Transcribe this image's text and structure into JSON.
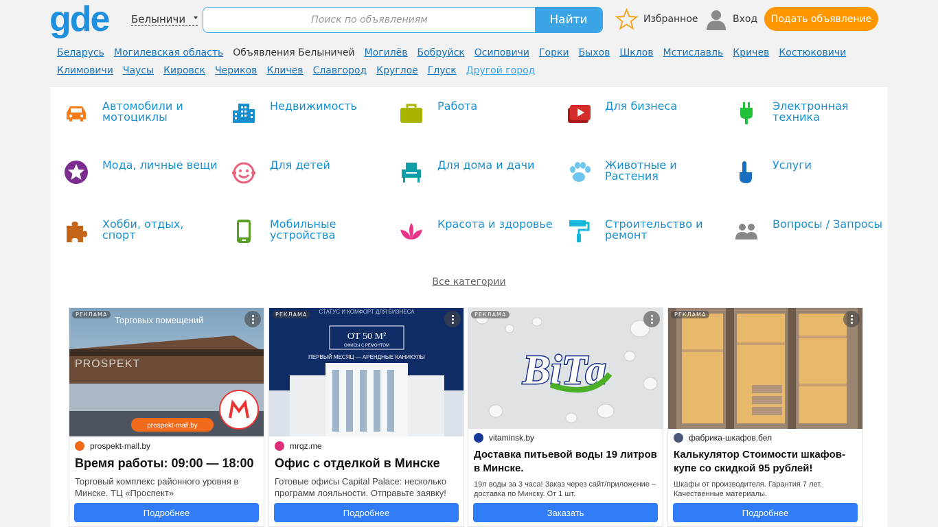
{
  "header": {
    "logo": "gde",
    "city": "Белыничи",
    "search_placeholder": "Поиск по объявлениям",
    "search_button": "Найти",
    "favorites": "Избранное",
    "login": "Вход",
    "post_ad": "Подать объявление",
    "accent": "#3ba5e8",
    "post_color": "#ff9800"
  },
  "cities": [
    {
      "label": "Беларусь"
    },
    {
      "label": "Могилевская область"
    },
    {
      "label": "Объявления Белыничей",
      "current": true
    },
    {
      "label": "Могилёв"
    },
    {
      "label": "Бобруйск"
    },
    {
      "label": "Осиповичи"
    },
    {
      "label": "Горки"
    },
    {
      "label": "Быхов"
    },
    {
      "label": "Шклов"
    },
    {
      "label": "Мстиславль"
    },
    {
      "label": "Кричев"
    },
    {
      "label": "Костюковичи"
    },
    {
      "label": "Климовичи"
    },
    {
      "label": "Чаусы"
    },
    {
      "label": "Кировск"
    },
    {
      "label": "Чериков"
    },
    {
      "label": "Кличев"
    },
    {
      "label": "Славгород"
    },
    {
      "label": "Круглое"
    },
    {
      "label": "Глуск"
    },
    {
      "label": "Другой город",
      "other": true
    }
  ],
  "categories": [
    {
      "label": "Автомобили и мотоциклы",
      "icon": "car-icon",
      "color": "#f47c1c"
    },
    {
      "label": "Недвижимость",
      "icon": "building-icon",
      "color": "#1a8fd0"
    },
    {
      "label": "Работа",
      "icon": "briefcase-icon",
      "color": "#a8b400"
    },
    {
      "label": "Для бизнеса",
      "icon": "video-icon",
      "color": "#d42b2b"
    },
    {
      "label": "Электронная техника",
      "icon": "plug-icon",
      "color": "#22c13b"
    },
    {
      "label": "Мода, личные вещи",
      "icon": "star-icon",
      "color": "#7b2d8f"
    },
    {
      "label": "Для детей",
      "icon": "smile-icon",
      "color": "#e8607a"
    },
    {
      "label": "Для дома и дачи",
      "icon": "armchair-icon",
      "color": "#0e9fa8"
    },
    {
      "label": "Животные и Растения",
      "icon": "paw-icon",
      "color": "#6ec6ee"
    },
    {
      "label": "Услуги",
      "icon": "hand-icon",
      "color": "#1a6fc0"
    },
    {
      "label": "Хобби, отдых, спорт",
      "icon": "puzzle-icon",
      "color": "#c4651a"
    },
    {
      "label": "Мобильные устройства",
      "icon": "phone-icon",
      "color": "#5aa028"
    },
    {
      "label": "Красота и здоровье",
      "icon": "lotus-icon",
      "color": "#e8348a"
    },
    {
      "label": "Строительство и ремонт",
      "icon": "paint-roller-icon",
      "color": "#14b8d8"
    },
    {
      "label": "Вопросы / Запросы",
      "icon": "people-icon",
      "color": "#888888"
    }
  ],
  "all_categories": "Все категории",
  "ads": [
    {
      "tag": "РЕКЛАМА",
      "img_text": "Торговых помещений",
      "img_brand": "PROSPEKT",
      "img_site": "prospekt-mall.by",
      "source": "prospekt-mall.by",
      "source_color": "#f26a1b",
      "title": "Время работы: 09:00 — 18:00",
      "desc": "Торговый комплекс районного уровня в Минске. ТЦ «Проспект»",
      "cta": "Подробнее"
    },
    {
      "tag": "РЕКЛАМА",
      "img_text": "СТАТУС И КОМФОРТ ДЛЯ БИЗНЕСА",
      "img_price": "ОТ 50 М²",
      "img_sub": "ОФИСЫ С РЕМОНТОМ",
      "img_offer": "ПЕРВЫЙ МЕСЯЦ — АРЕНДНЫЕ КАНИКУЛЫ",
      "source": "mrqz.me",
      "source_color": "#e0307a",
      "title": "Офис с отделкой в Минске",
      "desc": "Готовые офисы Capital Palace: несколько программ лояльности. Отправьте заявку!",
      "cta": "Подробнее"
    },
    {
      "tag": "РЕКЛАМА",
      "img_brand": "ВіТа",
      "source": "vitaminsk.by",
      "source_color": "#1a3a9a",
      "title": "Доставка питьевой воды 19 литров в Минске.",
      "desc": "19л воды за 3 часа! Заказ через сайт/приложение – доставка по Минску. От 1 шт.",
      "cta": "Заказать"
    },
    {
      "tag": "РЕКЛАМА",
      "source": "фабрика-шкафов.бел",
      "source_color": "#4a5a78",
      "title": "Калькулятор Стоимости шкафов-купе со скидкой 95 рублей!",
      "desc": "Шкафы от производителя. Гарантия 7 лет. Качественные материалы.",
      "cta": "Подробнее"
    }
  ]
}
